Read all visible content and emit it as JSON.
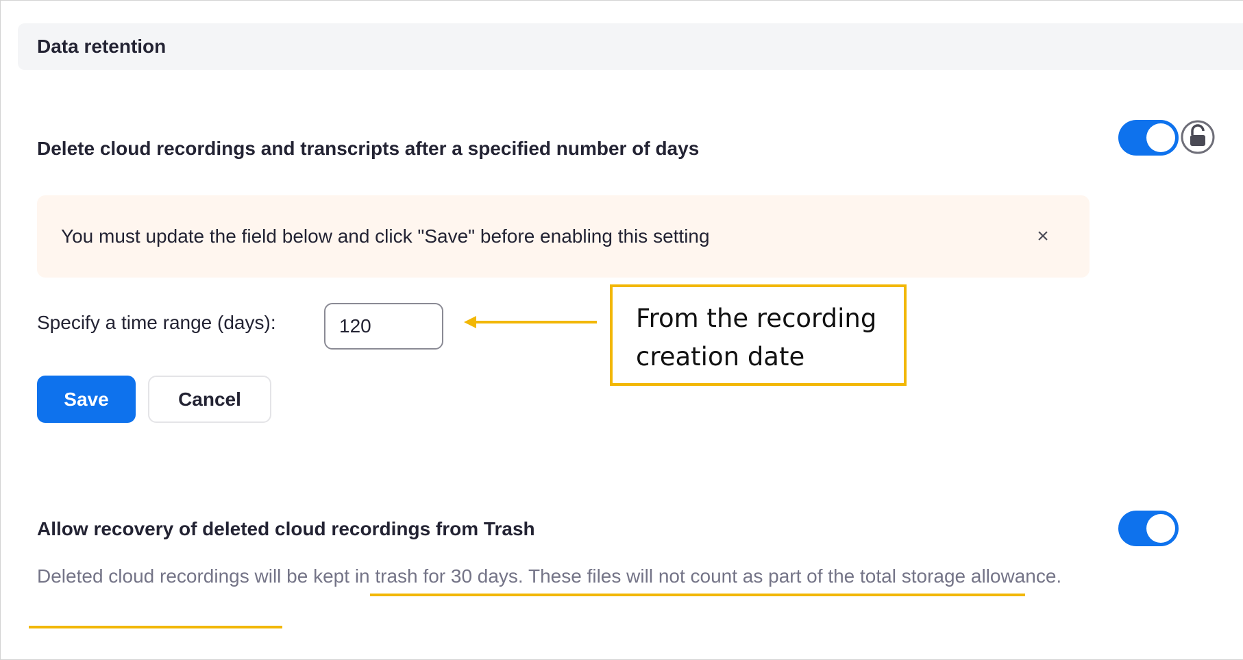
{
  "section": {
    "title": "Data retention"
  },
  "delete_setting": {
    "title": "Delete cloud recordings and transcripts after a specified number of days",
    "toggle_on": true
  },
  "alert": {
    "message": "You must update the field below and click \"Save\" before enabling this setting",
    "close_glyph": "×"
  },
  "time_range": {
    "label": "Specify a time range (days):",
    "value": "120"
  },
  "buttons": {
    "save": "Save",
    "cancel": "Cancel"
  },
  "annotation": {
    "callout_line1": "From the recording",
    "callout_line2": "creation date"
  },
  "recovery_setting": {
    "title": "Allow recovery of deleted cloud recordings from Trash",
    "toggle_on": true,
    "description_part1": "Deleted cloud recordings will be ",
    "description_part2": "kept in trash for 30 days. These files will not count as part of the total storage allowance."
  },
  "colors": {
    "accent": "#0e72ed",
    "annotation": "#f2b705",
    "alert_bg": "#fff6ef",
    "header_bg": "#f4f5f7"
  },
  "icons": {
    "lock": "unlocked-padlock-icon",
    "close": "close-icon",
    "arrow": "arrow-left-icon"
  }
}
